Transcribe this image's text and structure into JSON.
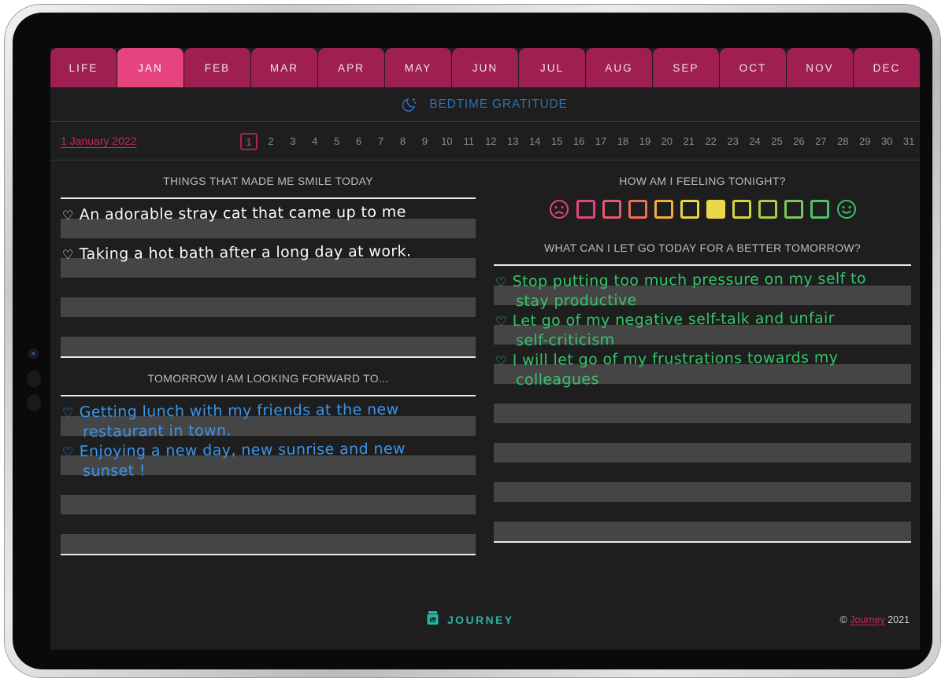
{
  "device": {
    "camera": "front-camera",
    "buttons": [
      "volume-up",
      "volume-down"
    ]
  },
  "tabs": [
    {
      "label": "LIFE",
      "active": false
    },
    {
      "label": "JAN",
      "active": true
    },
    {
      "label": "FEB",
      "active": false
    },
    {
      "label": "MAR",
      "active": false
    },
    {
      "label": "APR",
      "active": false
    },
    {
      "label": "MAY",
      "active": false
    },
    {
      "label": "JUN",
      "active": false
    },
    {
      "label": "JUL",
      "active": false
    },
    {
      "label": "AUG",
      "active": false
    },
    {
      "label": "SEP",
      "active": false
    },
    {
      "label": "OCT",
      "active": false
    },
    {
      "label": "NOV",
      "active": false
    },
    {
      "label": "DEC",
      "active": false
    }
  ],
  "header": {
    "icon": "crescent-moon-stars-icon",
    "title": "BEDTIME GRATITUDE",
    "title_color": "#2f6fb5"
  },
  "date_bar": {
    "label": "1 January 2022",
    "label_color": "#c9255e",
    "selected_day": 1,
    "days": [
      1,
      2,
      3,
      4,
      5,
      6,
      7,
      8,
      9,
      10,
      11,
      12,
      13,
      14,
      15,
      16,
      17,
      18,
      19,
      20,
      21,
      22,
      23,
      24,
      25,
      26,
      27,
      28,
      29,
      30,
      31
    ]
  },
  "left_column": {
    "section_1": {
      "title": "THINGS THAT MADE ME SMILE TODAY",
      "entries": [
        {
          "bullet": "♡",
          "line1": "An adorable stray cat that came up to me",
          "line2": "",
          "color": "#fbfbfb"
        },
        {
          "bullet": "♡",
          "line1": "Taking a hot bath after a long day at work.",
          "line2": "",
          "color": "#fbfbfb"
        },
        {
          "bullet": "",
          "line1": "",
          "line2": "",
          "color": "#fbfbfb"
        },
        {
          "bullet": "",
          "line1": "",
          "line2": "",
          "color": "#fbfbfb"
        }
      ]
    },
    "section_2": {
      "title": "TOMORROW I AM LOOKING FORWARD TO...",
      "entries": [
        {
          "bullet": "♡",
          "line1": "Getting lunch with my friends at the new",
          "line2": "restaurant in town.",
          "color": "#3d94e8"
        },
        {
          "bullet": "♡",
          "line1": "Enjoying a new day, new sunrise and new",
          "line2": "sunset !",
          "color": "#3d94e8"
        },
        {
          "bullet": "",
          "line1": "",
          "line2": "",
          "color": "#3d94e8"
        },
        {
          "bullet": "",
          "line1": "",
          "line2": "",
          "color": "#3d94e8"
        }
      ]
    }
  },
  "right_column": {
    "mood": {
      "title": "HOW AM I FEELING TONIGHT?",
      "sad_face_color": "#e5447e",
      "happy_face_color": "#35c46b",
      "selected_index": 5,
      "selected_color": "#e8d84a",
      "swatches": [
        "#e5447e",
        "#e7576e",
        "#ea6f55",
        "#edb13d",
        "#e8d84a",
        "#e5d83f",
        "#d3d441",
        "#a9cf4a",
        "#79c95a",
        "#4cc467"
      ]
    },
    "section": {
      "title": "WHAT CAN I LET GO TODAY FOR A BETTER TOMORROW?",
      "entries": [
        {
          "bullet": "♡",
          "line1": "Stop putting too much pressure on my self to",
          "line2": "stay productive",
          "color": "#35c46b"
        },
        {
          "bullet": "♡",
          "line1": "Let go of my negative self-talk and unfair",
          "line2": "self-criticism",
          "color": "#35c46b"
        },
        {
          "bullet": "♡",
          "line1": "I will let go of my frustrations towards my",
          "line2": "colleagues",
          "color": "#35c46b"
        },
        {
          "bullet": "",
          "line1": "",
          "line2": "",
          "color": "#35c46b"
        },
        {
          "bullet": "",
          "line1": "",
          "line2": "",
          "color": "#35c46b"
        },
        {
          "bullet": "",
          "line1": "",
          "line2": "",
          "color": "#35c46b"
        },
        {
          "bullet": "",
          "line1": "",
          "line2": "",
          "color": "#35c46b"
        }
      ]
    }
  },
  "footer": {
    "brand_icon": "journey-jar-icon",
    "brand": "JOURNEY",
    "copyright_symbol": "©",
    "copyright_link": "Journey",
    "copyright_year": "2021"
  }
}
